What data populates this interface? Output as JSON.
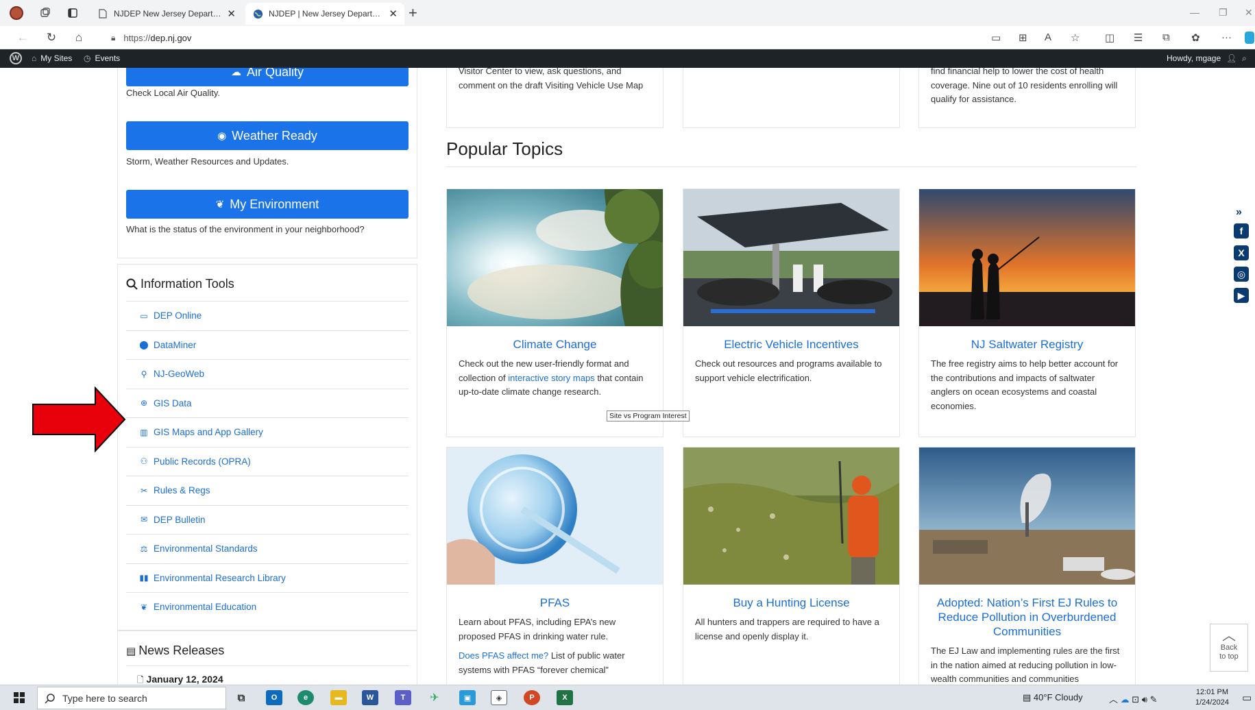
{
  "browser": {
    "tabs": [
      {
        "title": "NJDEP New Jersey Department o",
        "active": false
      },
      {
        "title": "NJDEP | New Jersey Department",
        "active": true
      }
    ],
    "url_proto": "https://",
    "url_host": "dep.nj.gov"
  },
  "wpbar": {
    "my_sites": "My Sites",
    "events": "Events",
    "howdy": "Howdy, mgage"
  },
  "sidebar": {
    "air_quality": {
      "label": "Air Quality",
      "desc": "Check Local Air Quality."
    },
    "weather_ready": {
      "label": "Weather Ready",
      "desc": "Storm, Weather Resources and Updates."
    },
    "my_environment": {
      "label": "My Environment",
      "desc": "What is the status of the environment in your neighborhood?"
    },
    "info_tools_title": "Information Tools",
    "info_tools": [
      {
        "label": "DEP Online",
        "icon": "monitor-icon"
      },
      {
        "label": "DataMiner",
        "icon": "map-pin-icon"
      },
      {
        "label": "NJ-GeoWeb",
        "icon": "pushpin-icon"
      },
      {
        "label": "GIS Data",
        "icon": "globe-icon"
      },
      {
        "label": "GIS Maps and App Gallery",
        "icon": "map-icon"
      },
      {
        "label": "Public Records (OPRA)",
        "icon": "users-icon"
      },
      {
        "label": "Rules & Regs",
        "icon": "tools-icon"
      },
      {
        "label": "DEP Bulletin",
        "icon": "envelope-open-icon"
      },
      {
        "label": "Environmental Standards",
        "icon": "scale-icon"
      },
      {
        "label": "Environmental Research Library",
        "icon": "book-icon"
      },
      {
        "label": "Environmental Education",
        "icon": "seedling-icon"
      }
    ],
    "news_title": "News Releases",
    "news_date": "January 12, 2024"
  },
  "top_cards": {
    "card1_text": "Visitor Center to view, ask questions, and comment on the draft Visiting Vehicle Use Map",
    "card3_text": "find financial help to lower the cost of health coverage. Nine out of 10 residents enrolling will qualify for assistance."
  },
  "popular": {
    "title": "Popular Topics",
    "cards": [
      {
        "title": "Climate Change",
        "text_pre": "Check out the new user-friendly format and collection of ",
        "link": "interactive story maps",
        "text_post": " that contain up-to-date climate change research."
      },
      {
        "title": "Electric Vehicle Incentives",
        "text": "Check out resources and programs available to support vehicle electrification."
      },
      {
        "title": "NJ Saltwater Registry",
        "text": "The free registry aims to help better account for the contributions and impacts of saltwater anglers on ocean ecosystems and coastal economies."
      },
      {
        "title": "PFAS",
        "text": "Learn about PFAS, including EPA’s new proposed PFAS in drinking water rule.",
        "link": "Does PFAS affect me?",
        "text_post": " List of public water systems with PFAS “forever chemical”"
      },
      {
        "title": "Buy a Hunting License",
        "text": "All hunters and trappers are required to have a license and openly display it."
      },
      {
        "title": "Adopted: Nation’s First EJ Rules to Reduce Pollution in Overburdened Communities",
        "text": "The EJ Law and implementing rules are the first in the nation aimed at reducing pollution in low-wealth communities and communities"
      }
    ]
  },
  "tooltip": "Site vs Program Interest",
  "back_to_top": {
    "line1": "Back",
    "line2": "to top"
  },
  "taskbar": {
    "search_placeholder": "Type here to search",
    "weather": "40°F  Cloudy",
    "time": "12:01 PM",
    "date": "1/24/2024"
  },
  "colors": {
    "primary": "#1a73e8",
    "link": "#1a6fd6",
    "wpbar": "#1d2327",
    "arrow": "#e8000b"
  }
}
